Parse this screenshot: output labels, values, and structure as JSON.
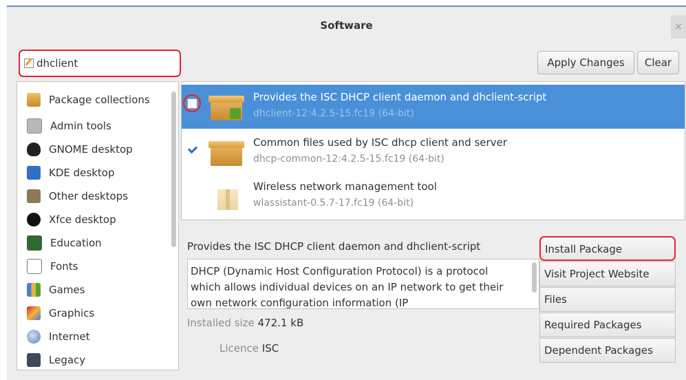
{
  "window": {
    "title": "Software",
    "close_label": "×"
  },
  "search": {
    "value": "dhclient",
    "icon": "pencil-icon"
  },
  "toolbar": {
    "apply_label": "Apply Changes",
    "clear_label": "Clear"
  },
  "sidebar": {
    "items": [
      {
        "label": "Package collections",
        "icon": "package-collections-icon"
      },
      {
        "label": "Admin tools",
        "icon": "admin-tools-icon"
      },
      {
        "label": "GNOME desktop",
        "icon": "gnome-foot-icon"
      },
      {
        "label": "KDE desktop",
        "icon": "kde-icon"
      },
      {
        "label": "Other desktops",
        "icon": "other-desktops-icon"
      },
      {
        "label": "Xfce desktop",
        "icon": "xfce-mouse-icon"
      },
      {
        "label": "Education",
        "icon": "education-icon"
      },
      {
        "label": "Fonts",
        "icon": "fonts-icon"
      },
      {
        "label": "Games",
        "icon": "games-icon"
      },
      {
        "label": "Graphics",
        "icon": "graphics-icon"
      },
      {
        "label": "Internet",
        "icon": "internet-globe-icon"
      },
      {
        "label": "Legacy",
        "icon": "legacy-floppy-icon"
      }
    ]
  },
  "packages": [
    {
      "summary": "Provides the ISC DHCP client daemon and dhclient-script",
      "name": "dhclient-12:4.2.5-15.fc19 (64-bit)",
      "checked": false,
      "selected": true
    },
    {
      "summary": "Common files used by ISC dhcp client and server",
      "name": "dhcp-common-12:4.2.5-15.fc19 (64-bit)",
      "checked": true,
      "selected": false
    },
    {
      "summary": "Wireless network management tool",
      "name": "wlassistant-0.5.7-17.fc19 (64-bit)",
      "checked": false,
      "selected": false
    }
  ],
  "details": {
    "summary": "Provides the ISC DHCP client daemon and dhclient-script",
    "description": "DHCP (Dynamic Host Configuration Protocol) is a protocol which allows individual devices on an IP network to get their own network configuration information (IP",
    "installed_size_label": "Installed size",
    "installed_size_value": "472.1 kB",
    "licence_label": "Licence",
    "licence_value": "ISC"
  },
  "actions": {
    "install_label": "Install Package",
    "website_label": "Visit Project Website",
    "files_label": "Files",
    "required_label": "Required Packages",
    "dependent_label": "Dependent Packages"
  },
  "colors": {
    "selection": "#4a90d9",
    "highlight_annotation": "#e0262b"
  }
}
